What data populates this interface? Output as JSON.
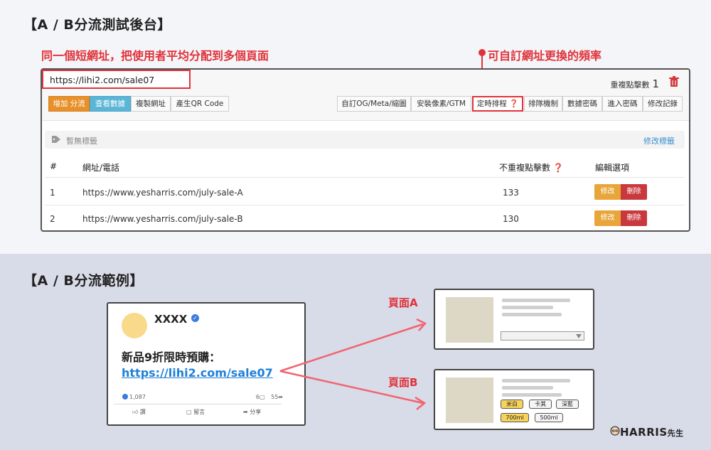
{
  "titles": {
    "backend": "【A / B分流測試後台】",
    "example": "【A / B分流範例】"
  },
  "captions": {
    "left": "同一個短網址，把使用者平均分配到多個頁面",
    "right": "可自訂網址更換的頻率"
  },
  "panel": {
    "short_url": "https://lihi2.com/sale07",
    "dup_label": "重複點擊數",
    "dup_count": "1",
    "left_buttons": [
      "增加 分流",
      "查看數據",
      "複製網址",
      "產生QR Code"
    ],
    "right_buttons": [
      "自訂OG/Meta/縮圖",
      "安裝像素/GTM",
      "定時排程 ❓",
      "排隊機制",
      "數據密碼",
      "進入密碼",
      "修改記錄"
    ],
    "tag_text": "暫無標籤",
    "tag_edit": "修改標籤",
    "columns": [
      "#",
      "網址/電話",
      "不重複點擊數 ❓",
      "編輯選項"
    ],
    "rows": [
      {
        "index": "1",
        "url": "https://www.yesharris.com/july-sale-A",
        "clicks": "133"
      },
      {
        "index": "2",
        "url": "https://www.yesharris.com/july-sale-B",
        "clicks": "130"
      }
    ],
    "edit_label": "修改",
    "delete_label": "刪除"
  },
  "post": {
    "name": "XXXX",
    "text": "新品9折限時預購：",
    "link": "https://lihi2.com/sale07",
    "likes": "1,087",
    "comments": "6",
    "shares": "55",
    "actions": [
      "讚",
      "留言",
      "分享"
    ]
  },
  "pages": {
    "a_label": "頁面A",
    "b_label": "頁面B",
    "b_chips_row1": [
      "米白",
      "卡其",
      "深藍"
    ],
    "b_chips_row2": [
      "700ml",
      "500ml"
    ]
  },
  "brand": {
    "name": "HARRIS",
    "suffix": "先生"
  },
  "colors": {
    "accent_red": "#e0323a",
    "link_blue": "#1f80d8",
    "orange": "#e8902a"
  }
}
